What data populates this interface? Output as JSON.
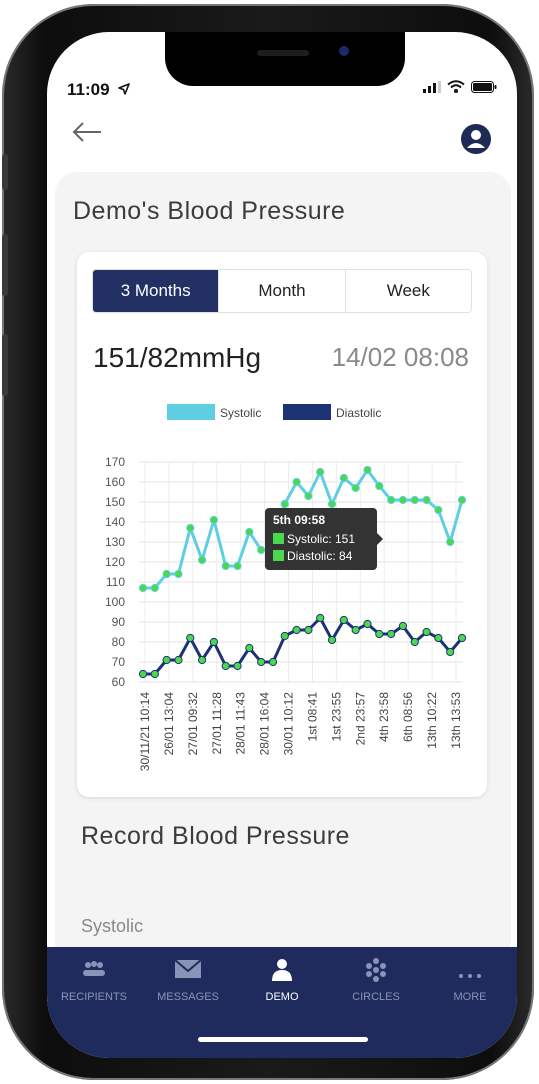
{
  "status_bar": {
    "time": "11:09",
    "location_arrow": "location-arrow-icon"
  },
  "header": {
    "back_icon": "back-arrow-icon",
    "profile_icon": "user-circle-icon"
  },
  "title": "Demo's Blood Pressure",
  "period_tabs": [
    {
      "label": "3 Months",
      "active": true
    },
    {
      "label": "Month",
      "active": false
    },
    {
      "label": "Week",
      "active": false
    }
  ],
  "latest_reading": {
    "value": "151/82mmHg",
    "timestamp": "14/02 08:08"
  },
  "colors": {
    "systolic": "#5ecfe3",
    "diastolic": "#1b3374",
    "accent": "#223063",
    "tooltip_swatch": "#4cd84c"
  },
  "tooltip": {
    "title": "5th 09:58",
    "systolic": "Systolic: 151",
    "diastolic": "Diastolic: 84"
  },
  "chart_data": {
    "type": "line",
    "categories": [
      "30/11/21 10:14",
      "26/01 13:04",
      "27/01 09:32",
      "27/01 11:28",
      "28/01 11:43",
      "28/01 16:04",
      "30/01 10:12",
      "1st 08:41",
      "1st 23:55",
      "2nd 23:57",
      "4th 23:58",
      "6th 08:56",
      "13th 10:22",
      "13th 13:53"
    ],
    "series": [
      {
        "name": "Systolic",
        "values": [
          107,
          107,
          114,
          114,
          137,
          121,
          141,
          118,
          118,
          135,
          126,
          126,
          149,
          160,
          153,
          165,
          149,
          162,
          157,
          166,
          158,
          151,
          151,
          151,
          151,
          146,
          130,
          151
        ]
      },
      {
        "name": "Diastolic",
        "values": [
          64,
          64,
          71,
          71,
          82,
          71,
          80,
          68,
          68,
          77,
          70,
          70,
          83,
          86,
          86,
          92,
          81,
          91,
          86,
          89,
          84,
          84,
          88,
          80,
          85,
          82,
          75,
          82
        ]
      }
    ],
    "ylim": [
      60,
      170
    ],
    "yticks": [
      "170",
      "160",
      "150",
      "140",
      "130",
      "120",
      "110",
      "100",
      "90",
      "80",
      "70",
      "60"
    ],
    "grid": true,
    "legend": "top"
  },
  "record_title": "Record Blood Pressure",
  "systolic_field_label": "Systolic",
  "nav": [
    {
      "label": "RECIPIENTS",
      "icon": "people-icon",
      "active": false
    },
    {
      "label": "MESSAGES",
      "icon": "envelope-icon",
      "active": false
    },
    {
      "label": "DEMO",
      "icon": "person-icon",
      "active": true
    },
    {
      "label": "CIRCLES",
      "icon": "circles-icon",
      "active": false
    },
    {
      "label": "MORE",
      "icon": "more-dots-icon",
      "active": false
    }
  ]
}
